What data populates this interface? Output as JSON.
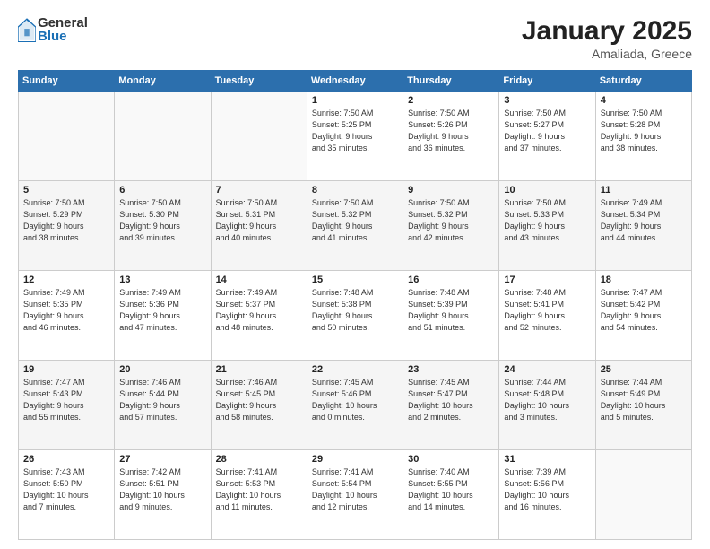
{
  "logo": {
    "general": "General",
    "blue": "Blue"
  },
  "header": {
    "month": "January 2025",
    "location": "Amaliada, Greece"
  },
  "weekdays": [
    "Sunday",
    "Monday",
    "Tuesday",
    "Wednesday",
    "Thursday",
    "Friday",
    "Saturday"
  ],
  "weeks": [
    [
      {
        "day": "",
        "info": ""
      },
      {
        "day": "",
        "info": ""
      },
      {
        "day": "",
        "info": ""
      },
      {
        "day": "1",
        "info": "Sunrise: 7:50 AM\nSunset: 5:25 PM\nDaylight: 9 hours\nand 35 minutes."
      },
      {
        "day": "2",
        "info": "Sunrise: 7:50 AM\nSunset: 5:26 PM\nDaylight: 9 hours\nand 36 minutes."
      },
      {
        "day": "3",
        "info": "Sunrise: 7:50 AM\nSunset: 5:27 PM\nDaylight: 9 hours\nand 37 minutes."
      },
      {
        "day": "4",
        "info": "Sunrise: 7:50 AM\nSunset: 5:28 PM\nDaylight: 9 hours\nand 38 minutes."
      }
    ],
    [
      {
        "day": "5",
        "info": "Sunrise: 7:50 AM\nSunset: 5:29 PM\nDaylight: 9 hours\nand 38 minutes."
      },
      {
        "day": "6",
        "info": "Sunrise: 7:50 AM\nSunset: 5:30 PM\nDaylight: 9 hours\nand 39 minutes."
      },
      {
        "day": "7",
        "info": "Sunrise: 7:50 AM\nSunset: 5:31 PM\nDaylight: 9 hours\nand 40 minutes."
      },
      {
        "day": "8",
        "info": "Sunrise: 7:50 AM\nSunset: 5:32 PM\nDaylight: 9 hours\nand 41 minutes."
      },
      {
        "day": "9",
        "info": "Sunrise: 7:50 AM\nSunset: 5:32 PM\nDaylight: 9 hours\nand 42 minutes."
      },
      {
        "day": "10",
        "info": "Sunrise: 7:50 AM\nSunset: 5:33 PM\nDaylight: 9 hours\nand 43 minutes."
      },
      {
        "day": "11",
        "info": "Sunrise: 7:49 AM\nSunset: 5:34 PM\nDaylight: 9 hours\nand 44 minutes."
      }
    ],
    [
      {
        "day": "12",
        "info": "Sunrise: 7:49 AM\nSunset: 5:35 PM\nDaylight: 9 hours\nand 46 minutes."
      },
      {
        "day": "13",
        "info": "Sunrise: 7:49 AM\nSunset: 5:36 PM\nDaylight: 9 hours\nand 47 minutes."
      },
      {
        "day": "14",
        "info": "Sunrise: 7:49 AM\nSunset: 5:37 PM\nDaylight: 9 hours\nand 48 minutes."
      },
      {
        "day": "15",
        "info": "Sunrise: 7:48 AM\nSunset: 5:38 PM\nDaylight: 9 hours\nand 50 minutes."
      },
      {
        "day": "16",
        "info": "Sunrise: 7:48 AM\nSunset: 5:39 PM\nDaylight: 9 hours\nand 51 minutes."
      },
      {
        "day": "17",
        "info": "Sunrise: 7:48 AM\nSunset: 5:41 PM\nDaylight: 9 hours\nand 52 minutes."
      },
      {
        "day": "18",
        "info": "Sunrise: 7:47 AM\nSunset: 5:42 PM\nDaylight: 9 hours\nand 54 minutes."
      }
    ],
    [
      {
        "day": "19",
        "info": "Sunrise: 7:47 AM\nSunset: 5:43 PM\nDaylight: 9 hours\nand 55 minutes."
      },
      {
        "day": "20",
        "info": "Sunrise: 7:46 AM\nSunset: 5:44 PM\nDaylight: 9 hours\nand 57 minutes."
      },
      {
        "day": "21",
        "info": "Sunrise: 7:46 AM\nSunset: 5:45 PM\nDaylight: 9 hours\nand 58 minutes."
      },
      {
        "day": "22",
        "info": "Sunrise: 7:45 AM\nSunset: 5:46 PM\nDaylight: 10 hours\nand 0 minutes."
      },
      {
        "day": "23",
        "info": "Sunrise: 7:45 AM\nSunset: 5:47 PM\nDaylight: 10 hours\nand 2 minutes."
      },
      {
        "day": "24",
        "info": "Sunrise: 7:44 AM\nSunset: 5:48 PM\nDaylight: 10 hours\nand 3 minutes."
      },
      {
        "day": "25",
        "info": "Sunrise: 7:44 AM\nSunset: 5:49 PM\nDaylight: 10 hours\nand 5 minutes."
      }
    ],
    [
      {
        "day": "26",
        "info": "Sunrise: 7:43 AM\nSunset: 5:50 PM\nDaylight: 10 hours\nand 7 minutes."
      },
      {
        "day": "27",
        "info": "Sunrise: 7:42 AM\nSunset: 5:51 PM\nDaylight: 10 hours\nand 9 minutes."
      },
      {
        "day": "28",
        "info": "Sunrise: 7:41 AM\nSunset: 5:53 PM\nDaylight: 10 hours\nand 11 minutes."
      },
      {
        "day": "29",
        "info": "Sunrise: 7:41 AM\nSunset: 5:54 PM\nDaylight: 10 hours\nand 12 minutes."
      },
      {
        "day": "30",
        "info": "Sunrise: 7:40 AM\nSunset: 5:55 PM\nDaylight: 10 hours\nand 14 minutes."
      },
      {
        "day": "31",
        "info": "Sunrise: 7:39 AM\nSunset: 5:56 PM\nDaylight: 10 hours\nand 16 minutes."
      },
      {
        "day": "",
        "info": ""
      }
    ]
  ]
}
